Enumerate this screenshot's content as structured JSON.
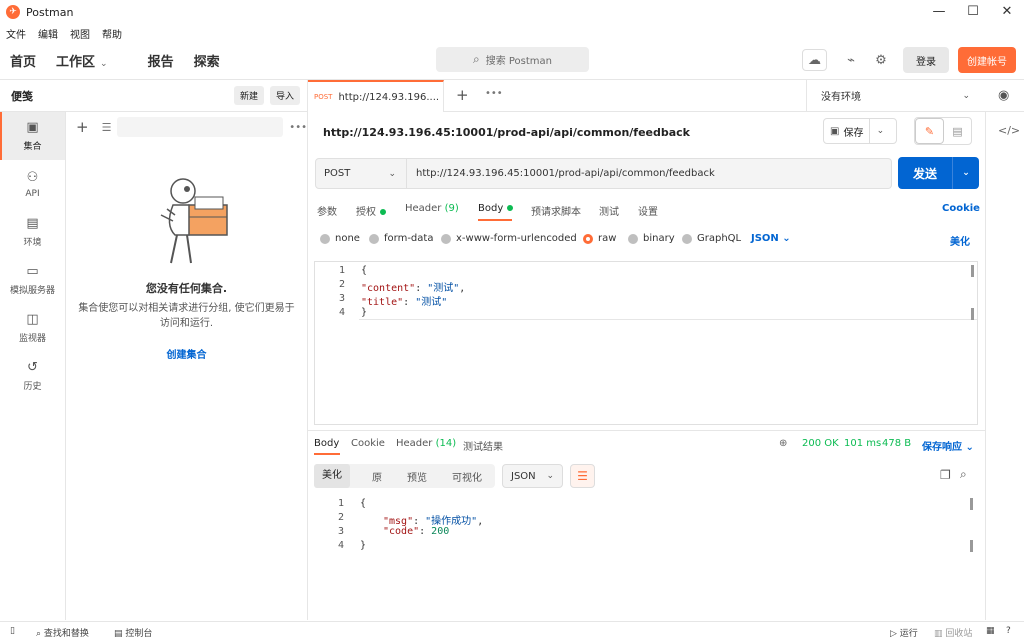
{
  "window": {
    "title": "Postman",
    "controls": [
      "—",
      "☐",
      "✕"
    ]
  },
  "menu": [
    "文件",
    "编辑",
    "视图",
    "帮助"
  ],
  "header": {
    "nav": [
      "首页",
      "工作区",
      "报告",
      "探索"
    ],
    "search_placeholder": "搜索 Postman",
    "login_label": "登录",
    "signup_label": "创建帐号"
  },
  "sidebar": {
    "title": "便笺",
    "new_label": "新建",
    "import_label": "导入",
    "rail": [
      {
        "label": "集合",
        "icon": "collections-icon"
      },
      {
        "label": "API",
        "icon": "api-icon"
      },
      {
        "label": "环境",
        "icon": "environment-icon"
      },
      {
        "label": "模拟服务器",
        "icon": "mock-server-icon"
      },
      {
        "label": "监视器",
        "icon": "monitor-icon"
      },
      {
        "label": "历史",
        "icon": "history-icon"
      }
    ],
    "empty_title": "您没有任何集合.",
    "empty_desc": "集合使您可以对相关请求进行分组, 使它们更易于访问和运行.",
    "create_link": "创建集合"
  },
  "tabbar": {
    "tab_method": "POST",
    "tab_url": "http://124.93.196....",
    "environment": "没有环境"
  },
  "request": {
    "name": "http://124.93.196.45:10001/prod-api/api/common/feedback",
    "save_label": "保存",
    "method": "POST",
    "url": "http://124.93.196.45:10001/prod-api/api/common/feedback",
    "send_label": "发送",
    "tabs": {
      "params": "参数",
      "auth": "授权",
      "headers": "Header",
      "headers_count": "(9)",
      "body": "Body",
      "prerequest": "预请求脚本",
      "tests": "测试",
      "settings": "设置",
      "cookies": "Cookie"
    },
    "body_types": [
      "none",
      "form-data",
      "x-www-form-urlencoded",
      "raw",
      "binary",
      "GraphQL"
    ],
    "body_type_selected": "raw",
    "body_format": "JSON",
    "beautify": "美化",
    "body_lines": [
      {
        "n": "1",
        "t": "{"
      },
      {
        "n": "2",
        "key": "\"content\"",
        "sep": ": ",
        "val": "\"测试\"",
        "end": ","
      },
      {
        "n": "3",
        "key": "\"title\"",
        "sep": ": ",
        "val": "\"测试\"",
        "end": ""
      },
      {
        "n": "4",
        "t": "}"
      }
    ]
  },
  "response": {
    "tabs": {
      "body": "Body",
      "cookies": "Cookie",
      "headers": "Header",
      "headers_count": "(14)",
      "test_results": "测试结果"
    },
    "status": "200 OK",
    "time": "101 ms",
    "size": "478 B",
    "save_response": "保存响应",
    "views": [
      "美化",
      "原",
      "预览",
      "可视化"
    ],
    "format": "JSON",
    "body_lines": [
      {
        "n": "1",
        "t": "{"
      },
      {
        "n": "2",
        "key": "\"msg\"",
        "sep": ": ",
        "val": "\"操作成功\"",
        "end": ","
      },
      {
        "n": "3",
        "key": "\"code\"",
        "sep": ": ",
        "num": "200",
        "end": ""
      },
      {
        "n": "4",
        "t": "}"
      }
    ]
  },
  "statusbar": {
    "find_replace": "查找和替换",
    "console": "控制台",
    "runner": "运行",
    "trash": "回收站"
  },
  "colors": {
    "accent": "#ff6c37",
    "primary": "#0265d2",
    "success": "#0cbb52"
  }
}
